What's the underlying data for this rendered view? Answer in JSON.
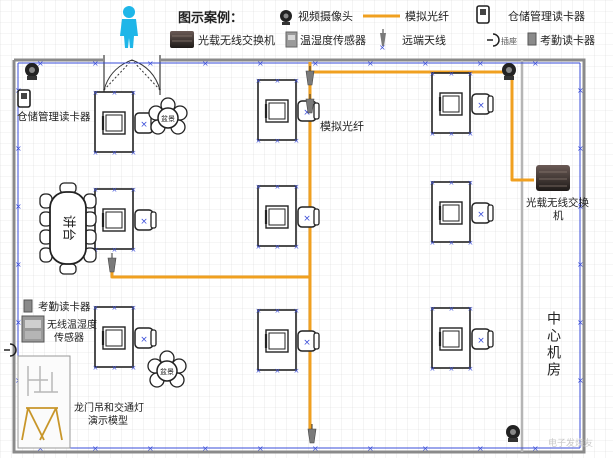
{
  "legend": {
    "title": "图示案例：",
    "camera": "视频摄像头",
    "fiber": "模拟光纤",
    "warehouse_reader": "仓储管理读卡器",
    "switch": "光载无线交换机",
    "sensor": "温湿度传感器",
    "antenna": "远端天线",
    "socket": "插座",
    "attendance_reader": "考勤读卡器"
  },
  "labels": {
    "warehouse_reader": "仓储管理读卡器",
    "fiber": "模拟光纤",
    "switch_line1": "光载无线交换",
    "switch_line2": "机",
    "podium": "讲台",
    "attendance_reader": "考勤读卡器",
    "sensor_line1": "无线温湿度",
    "sensor_line2": "传感器",
    "gantry_line1": "龙门吊和交通灯",
    "gantry_line2": "演示模型",
    "plant": "盆景",
    "machine_room": "中心机房",
    "watermark": "电子发烧友"
  },
  "colors": {
    "fiber": "#f0a020",
    "wall": "#888888",
    "wire": "#3a4dd8",
    "cyan": "#1fb6e8",
    "grid": "#d8d8d8"
  }
}
